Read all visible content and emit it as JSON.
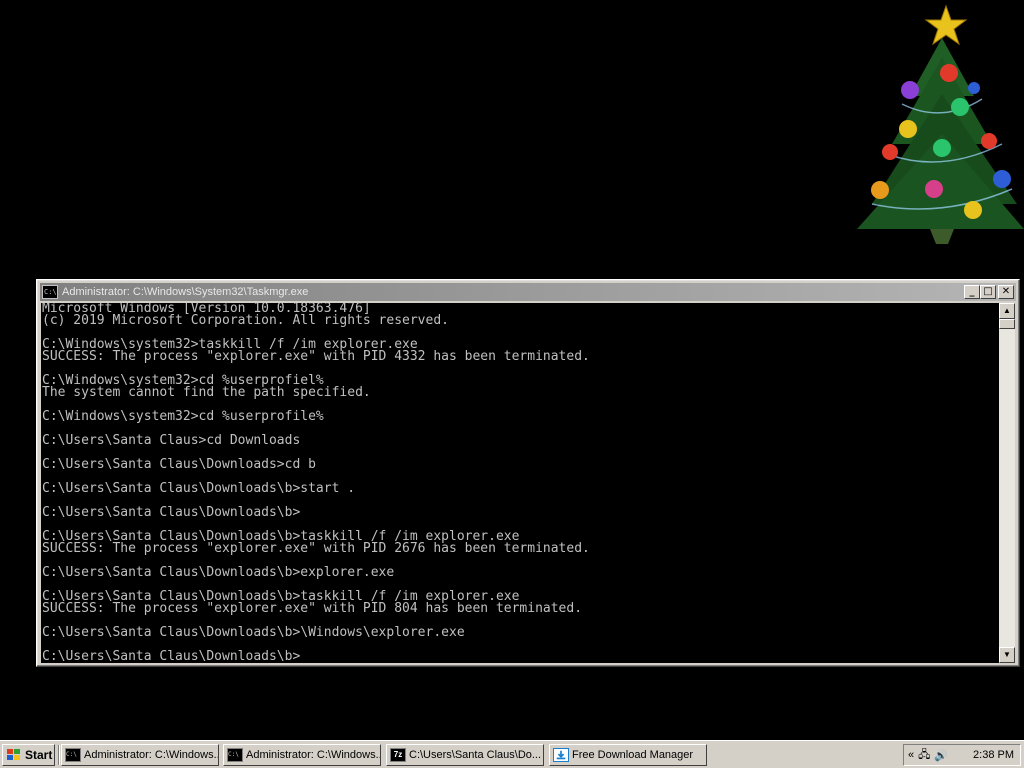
{
  "console": {
    "title": "Administrator: C:\\Windows\\System32\\Taskmgr.exe",
    "title_icon_text": "C:\\",
    "buttons": {
      "minimize": "_",
      "maximize": "□",
      "close": "✕"
    },
    "lines": [
      "Microsoft Windows [Version 10.0.18363.476]",
      "(c) 2019 Microsoft Corporation. All rights reserved.",
      "",
      "C:\\Windows\\system32>taskkill /f /im explorer.exe",
      "SUCCESS: The process \"explorer.exe\" with PID 4332 has been terminated.",
      "",
      "C:\\Windows\\system32>cd %userprofiel%",
      "The system cannot find the path specified.",
      "",
      "C:\\Windows\\system32>cd %userprofile%",
      "",
      "C:\\Users\\Santa Claus>cd Downloads",
      "",
      "C:\\Users\\Santa Claus\\Downloads>cd b",
      "",
      "C:\\Users\\Santa Claus\\Downloads\\b>start .",
      "",
      "C:\\Users\\Santa Claus\\Downloads\\b>",
      "",
      "C:\\Users\\Santa Claus\\Downloads\\b>taskkill /f /im explorer.exe",
      "SUCCESS: The process \"explorer.exe\" with PID 2676 has been terminated.",
      "",
      "C:\\Users\\Santa Claus\\Downloads\\b>explorer.exe",
      "",
      "C:\\Users\\Santa Claus\\Downloads\\b>taskkill /f /im explorer.exe",
      "SUCCESS: The process \"explorer.exe\" with PID 804 has been terminated.",
      "",
      "C:\\Users\\Santa Claus\\Downloads\\b>\\Windows\\explorer.exe",
      "",
      "C:\\Users\\Santa Claus\\Downloads\\b>"
    ]
  },
  "taskbar": {
    "start_label": "Start",
    "buttons": [
      {
        "label": "Administrator: C:\\Windows...",
        "icon": "cmd-icon"
      },
      {
        "label": "Administrator: C:\\Windows...",
        "icon": "cmd-icon"
      },
      {
        "label": "C:\\Users\\Santa Claus\\Do...",
        "icon": "7z-icon",
        "icon_text": "7z"
      },
      {
        "label": "Free Download Manager",
        "icon": "fdm-icon"
      }
    ],
    "tray": {
      "expand": "«",
      "network": "🖧",
      "volume": "🔊",
      "clock": "2:38 PM"
    }
  },
  "colors": {
    "desktop": "#000000",
    "console_bg": "#000000",
    "console_fg": "#c0c0c0",
    "titlebar_inactive": "#808080",
    "chrome": "#d4d0c8"
  }
}
